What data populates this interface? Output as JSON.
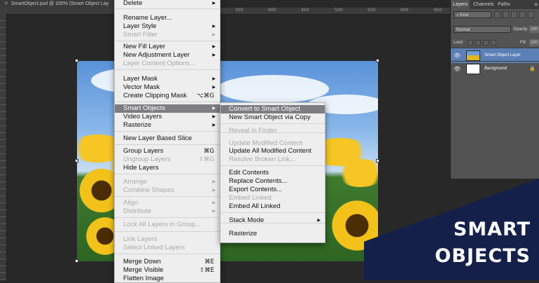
{
  "document": {
    "tab_title": "SmartObject.psd @ 100% (Smart Object Lay",
    "ruler_ticks": [
      "350",
      "400",
      "450",
      "500",
      "550",
      "600",
      "650"
    ]
  },
  "banner": {
    "line1": "SMART",
    "line2": "OBJECTS",
    "color": "#15204a"
  },
  "layers_panel": {
    "tabs": [
      "Layers",
      "Channels",
      "Paths"
    ],
    "kind": "Kind",
    "blend_mode": "Normal",
    "opacity_label": "Opacity:",
    "opacity_value": "100",
    "lock_label": "Lock:",
    "fill_label": "Fill:",
    "fill_value": "100",
    "layers": [
      {
        "name": "Smart Object Layer",
        "selected": true
      },
      {
        "name": "Background",
        "selected": false
      }
    ]
  },
  "context_menu": {
    "items": [
      {
        "label": "Delete",
        "arrow": true
      },
      {
        "separator": true
      },
      {
        "label": "Rename Layer..."
      },
      {
        "label": "Layer Style",
        "arrow": true
      },
      {
        "label": "Smart Filter",
        "arrow": true,
        "disabled": true
      },
      {
        "separator": true
      },
      {
        "label": "New Fill Layer",
        "arrow": true
      },
      {
        "label": "New Adjustment Layer",
        "arrow": true
      },
      {
        "label": "Layer Content Options...",
        "disabled": true
      },
      {
        "separator": true
      },
      {
        "label": "Layer Mask",
        "arrow": true
      },
      {
        "label": "Vector Mask",
        "arrow": true
      },
      {
        "label": "Create Clipping Mask",
        "shortcut": "⌥⌘G"
      },
      {
        "separator": true
      },
      {
        "label": "Smart Objects",
        "arrow": true,
        "highlighted": true
      },
      {
        "label": "Video Layers",
        "arrow": true
      },
      {
        "label": "Rasterize",
        "arrow": true
      },
      {
        "separator": true
      },
      {
        "label": "New Layer Based Slice"
      },
      {
        "separator": true
      },
      {
        "label": "Group Layers",
        "shortcut": "⌘G"
      },
      {
        "label": "Ungroup Layers",
        "shortcut": "⇧⌘G",
        "disabled": true
      },
      {
        "label": "Hide Layers"
      },
      {
        "separator": true
      },
      {
        "label": "Arrange",
        "arrow": true,
        "disabled": true
      },
      {
        "label": "Combine Shapes",
        "arrow": true,
        "disabled": true
      },
      {
        "separator": true
      },
      {
        "label": "Align",
        "arrow": true,
        "disabled": true
      },
      {
        "label": "Distribute",
        "arrow": true,
        "disabled": true
      },
      {
        "separator": true
      },
      {
        "label": "Lock All Layers in Group...",
        "disabled": true
      },
      {
        "separator": true
      },
      {
        "label": "Link Layers",
        "disabled": true
      },
      {
        "label": "Select Linked Layers",
        "disabled": true
      },
      {
        "separator": true
      },
      {
        "label": "Merge Down",
        "shortcut": "⌘E"
      },
      {
        "label": "Merge Visible",
        "shortcut": "⇧⌘E"
      },
      {
        "label": "Flatten Image"
      }
    ]
  },
  "smart_objects_submenu": {
    "items": [
      {
        "label": "Convert to Smart Object",
        "highlighted": true
      },
      {
        "label": "New Smart Object via Copy"
      },
      {
        "separator": true
      },
      {
        "label": "Reveal in Finder",
        "disabled": true
      },
      {
        "separator": true
      },
      {
        "label": "Update Modified Content",
        "disabled": true
      },
      {
        "label": "Update All Modified Content"
      },
      {
        "label": "Resolve Broken Link...",
        "disabled": true
      },
      {
        "separator": true
      },
      {
        "label": "Edit Contents"
      },
      {
        "label": "Replace Contents..."
      },
      {
        "label": "Export Contents..."
      },
      {
        "label": "Embed Linked",
        "disabled": true
      },
      {
        "label": "Embed All Linked"
      },
      {
        "separator": true
      },
      {
        "label": "Stack Mode",
        "arrow": true
      },
      {
        "separator": true
      },
      {
        "label": "Rasterize"
      }
    ]
  }
}
